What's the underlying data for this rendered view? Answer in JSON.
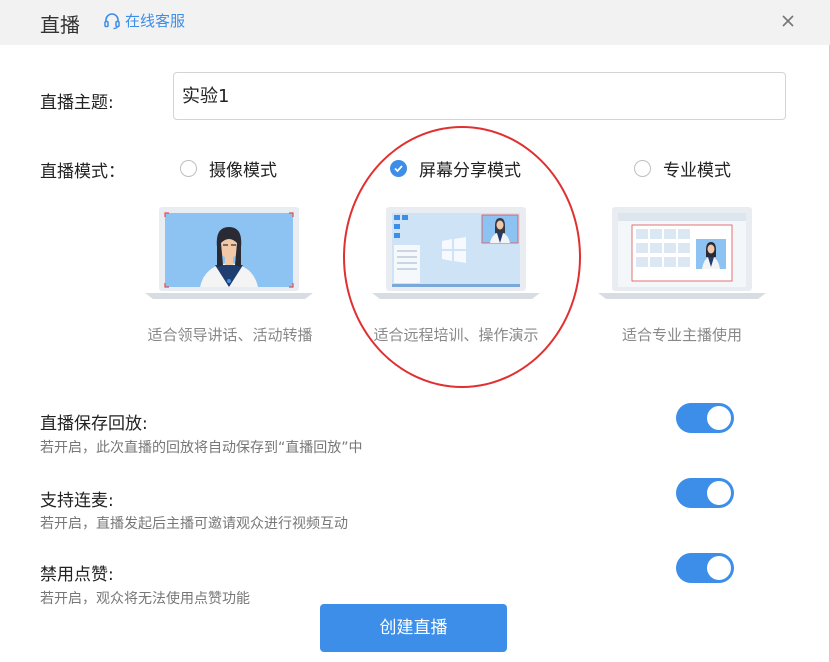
{
  "header": {
    "title": "直播",
    "support_label": "在线客服"
  },
  "topic": {
    "label": "直播主题:",
    "value": "实验1"
  },
  "mode": {
    "label": "直播模式：",
    "options": [
      {
        "label": "摄像模式",
        "caption": "适合领导讲话、活动转播",
        "selected": false
      },
      {
        "label": "屏幕分享模式",
        "caption": "适合远程培训、操作演示",
        "selected": true
      },
      {
        "label": "专业模式",
        "caption": "适合专业主播使用",
        "selected": false
      }
    ]
  },
  "settings": [
    {
      "title": "直播保存回放:",
      "desc": "若开启，此次直播的回放将自动保存到“直播回放”中",
      "enabled": true
    },
    {
      "title": "支持连麦:",
      "desc": "若开启，直播发起后主播可邀请观众进行视频互动",
      "enabled": true
    },
    {
      "title": "禁用点赞:",
      "desc": "若开启，观众将无法使用点赞功能",
      "enabled": true
    }
  ],
  "create_button_label": "创建直播",
  "colors": {
    "accent": "#3d8ee8",
    "annotation": "#e03030"
  }
}
